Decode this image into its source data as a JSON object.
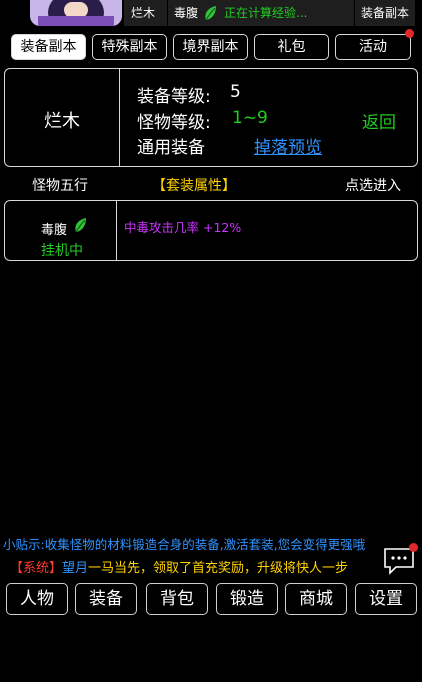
{
  "topbar": {
    "name": "烂木",
    "monster": "毒腹",
    "status": "正在计算经验...",
    "mode": "装备副本"
  },
  "tabs": [
    {
      "label": "装备副本",
      "active": true
    },
    {
      "label": "特殊副本",
      "active": false
    },
    {
      "label": "境界副本",
      "active": false
    },
    {
      "label": "礼包",
      "active": false
    },
    {
      "label": "活动",
      "active": false
    }
  ],
  "info": {
    "location": "烂木",
    "equip_level_label": "装备等级:",
    "equip_level_value": "5",
    "monster_level_label": "怪物等级:",
    "monster_level_value": "1~9",
    "general_equip": "通用装备",
    "drop_preview": "掉落预览",
    "back": "返回"
  },
  "header": {
    "col1": "怪物五行",
    "col2": "【套装属性】",
    "col3": "点选进入"
  },
  "monster_row": {
    "name": "毒腹",
    "state": "挂机中",
    "attribute": "中毒攻击几率 +12%"
  },
  "tip": "小贴示:收集怪物的材料锻造合身的装备,激活套装,您会变得更强哦",
  "system_message": {
    "tag": "【系统】",
    "player": "望月",
    "text": "一马当先，领取了首充奖励，升级将快人一步"
  },
  "nav": [
    "人物",
    "装备",
    "背包",
    "锻造",
    "商城",
    "设置"
  ],
  "colors": {
    "green": "#22cc22",
    "blue_link": "#2f93ff",
    "purple": "#cc33ff",
    "yellow": "#ffd400",
    "red_tag": "#ff3b2f",
    "dot_red": "#e3282a"
  },
  "icons": {
    "leaf": "leaf-icon",
    "chat": "chat-bubble-icon"
  }
}
